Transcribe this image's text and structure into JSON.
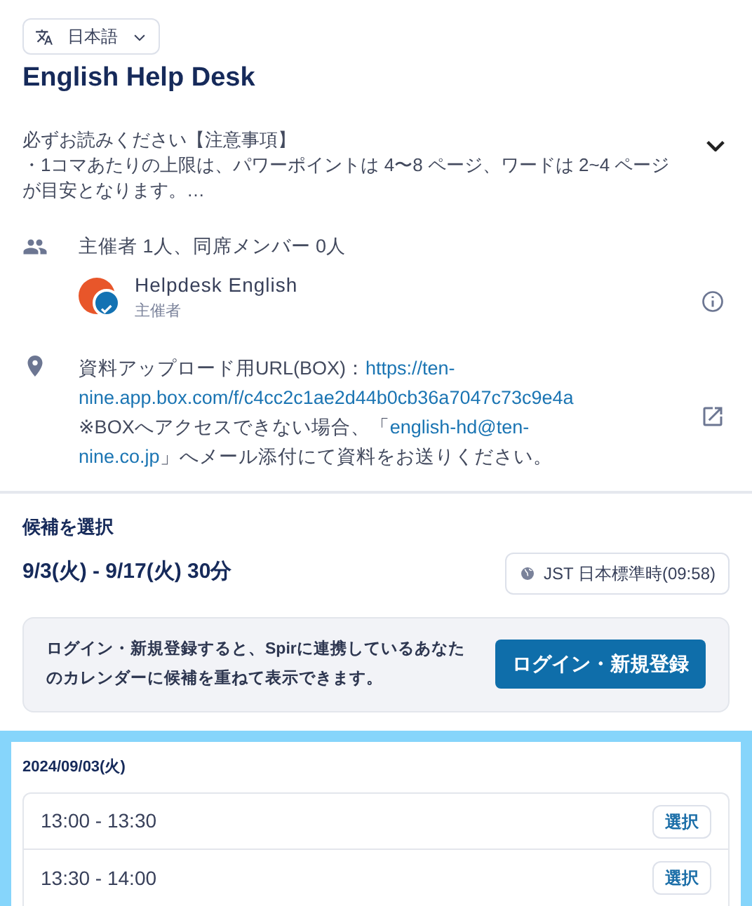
{
  "language": {
    "label": "日本語"
  },
  "title": "English Help Desk",
  "description": {
    "heading": "必ずお読みください【注意事項】",
    "body": "・1コマあたりの上限は、パワーポイントは 4〜8 ページ、ワードは 2~4 ページが目安となります。…",
    "expanded": false
  },
  "attendees": {
    "summary": "主催者 1人、同席メンバー 0人",
    "people": [
      {
        "name": "Helpdesk English",
        "role": "主催者",
        "color": "#e8562a"
      }
    ]
  },
  "location": {
    "lines": [
      [
        {
          "kind": "text",
          "text": "資料アップロード用URL(BOX)："
        },
        {
          "kind": "link",
          "text": "https://ten-"
        }
      ],
      [
        {
          "kind": "link",
          "text": "nine.app.box.com/f/c4cc2c1ae2d44b0cb36a7047c73c9e4a"
        }
      ],
      [
        {
          "kind": "text",
          "text": "※BOXへアクセスできない場合、「"
        },
        {
          "kind": "link",
          "text": "english-hd@ten-"
        }
      ],
      [
        {
          "kind": "link",
          "text": "nine.co.jp"
        },
        {
          "kind": "text",
          "text": "」へメール添付にて資料をお送りください。"
        }
      ]
    ]
  },
  "candidates": {
    "heading": "候補を選択",
    "range": "9/3(火) - 9/17(火) 30分",
    "timezone": "JST 日本標準時(09:58)"
  },
  "login_banner": {
    "text": "ログイン・新規登録すると、Spirに連携しているあなたのカレンダーに候補を重ねて表示できます。",
    "button": "ログイン・新規登録"
  },
  "days": [
    {
      "date": "2024/09/03(火)",
      "slots": [
        {
          "time": "13:00 - 13:30",
          "action": "選択"
        },
        {
          "time": "13:30 - 14:00",
          "action": "選択"
        }
      ]
    }
  ]
}
